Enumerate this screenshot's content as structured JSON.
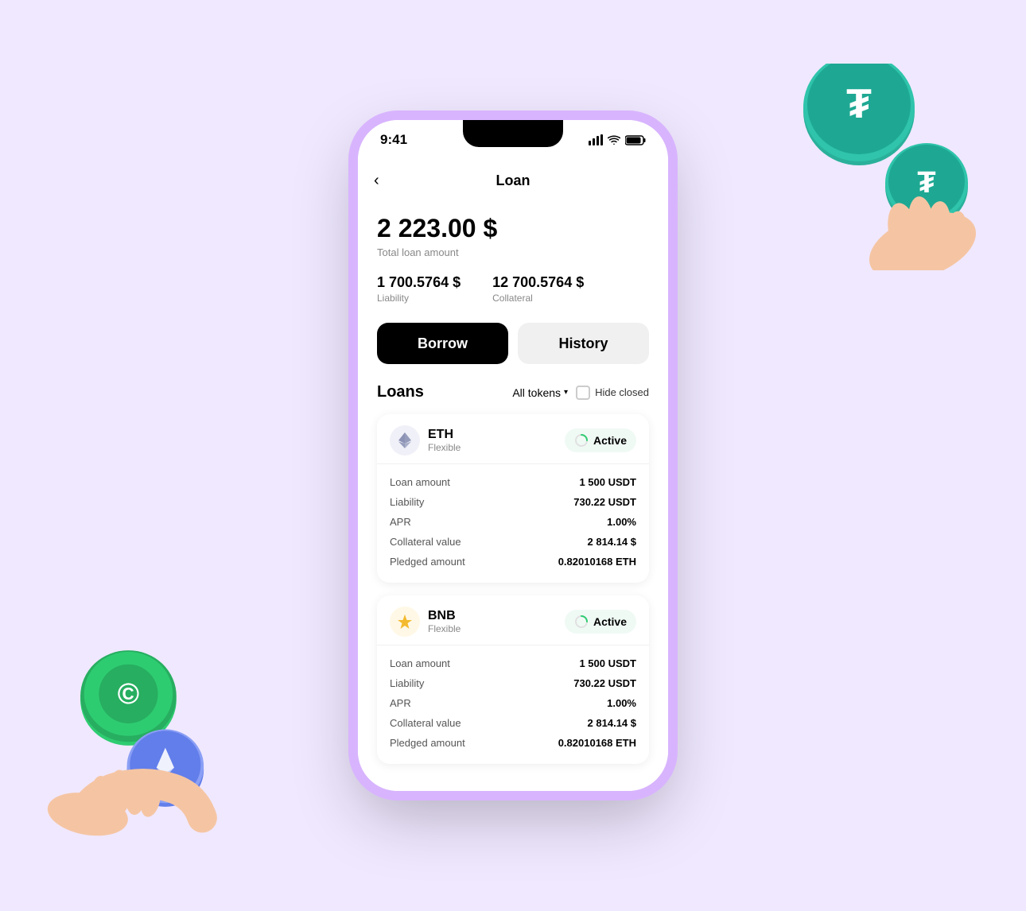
{
  "phone": {
    "statusBar": {
      "time": "9:41"
    },
    "header": {
      "title": "Loan",
      "backLabel": "‹"
    },
    "summary": {
      "totalAmount": "2 223.00 $",
      "totalLabel": "Total loan amount",
      "liability": {
        "value": "1 700.5764 $",
        "label": "Liability"
      },
      "collateral": {
        "value": "12 700.5764 $",
        "label": "Collateral"
      }
    },
    "tabs": [
      {
        "id": "borrow",
        "label": "Borrow",
        "active": true
      },
      {
        "id": "history",
        "label": "History",
        "active": false
      }
    ],
    "loans": {
      "title": "Loans",
      "filter": "All tokens",
      "hideClosed": "Hide closed",
      "items": [
        {
          "coin": "ETH",
          "type": "Flexible",
          "status": "Active",
          "rows": [
            {
              "label": "Loan amount",
              "value": "1 500 USDT"
            },
            {
              "label": "Liability",
              "value": "730.22 USDT"
            },
            {
              "label": "APR",
              "value": "1.00%"
            },
            {
              "label": "Collateral value",
              "value": "2 814.14 $"
            },
            {
              "label": "Pledged amount",
              "value": "0.82010168 ETH"
            }
          ]
        },
        {
          "coin": "BNB",
          "type": "Flexible",
          "status": "Active",
          "rows": [
            {
              "label": "Loan amount",
              "value": "1 500 USDT"
            },
            {
              "label": "Liability",
              "value": "730.22 USDT"
            },
            {
              "label": "APR",
              "value": "1.00%"
            },
            {
              "label": "Collateral value",
              "value": "2 814.14 $"
            },
            {
              "label": "Pledged amount",
              "value": "0.82010168 ETH"
            }
          ]
        }
      ]
    }
  }
}
